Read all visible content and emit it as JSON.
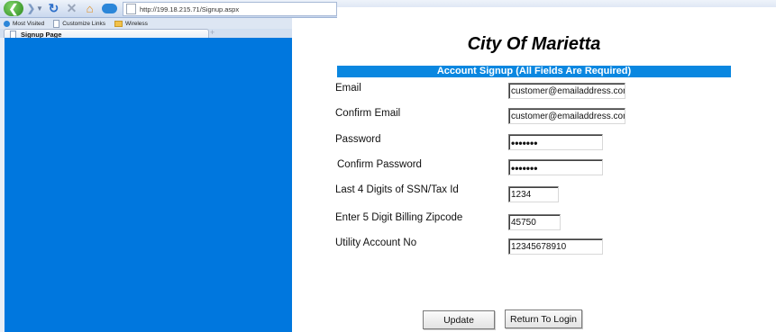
{
  "browser": {
    "url": "http://199.18.215.71/Signup.aspx",
    "bookmarks": [
      "Most Visited",
      "Customize Links",
      "Wireless"
    ],
    "tab_title": "Signup Page",
    "new_tab": "+"
  },
  "page": {
    "title": "City Of Marietta",
    "header": "Account Signup (All Fields Are Required)"
  },
  "form": {
    "email_label": "Email",
    "email_value": "customer@emailaddress.com",
    "confirm_email_label": "Confirm Email",
    "confirm_email_value": "customer@emailaddress.com",
    "password_label": "Password",
    "password_value": "•••••••",
    "confirm_password_label": "Confirm Password",
    "confirm_password_value": "•••••••",
    "ssn_label": "Last 4 Digits of SSN/Tax Id",
    "ssn_value": "1234",
    "zip_label": "Enter 5 Digit Billing Zipcode",
    "zip_value": "45750",
    "account_label": "Utility Account No",
    "account_value": "12345678910"
  },
  "buttons": {
    "update": "Update",
    "return": "Return To Login"
  }
}
